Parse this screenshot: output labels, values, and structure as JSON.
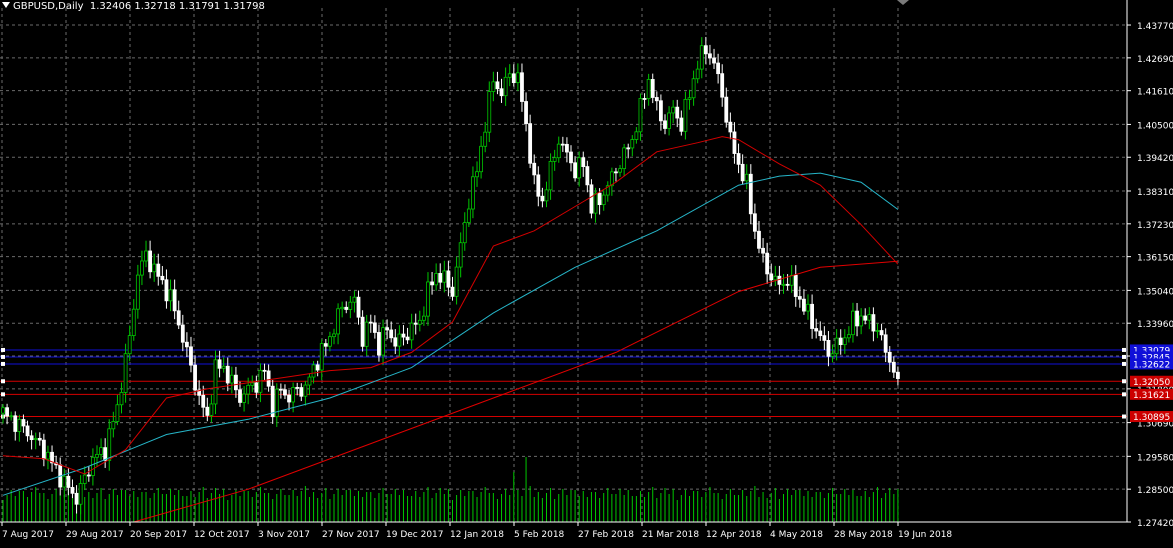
{
  "header": {
    "symbol": "GBPUSD,Daily",
    "ohlc": "1.32406 1.32718 1.31791 1.31798"
  },
  "colors": {
    "background": "#000000",
    "grid": "#6b6b6b",
    "candle_up": "#00c800",
    "candle_body_up": "#000000",
    "candle_down": "#ffffff",
    "volume": "#00c800",
    "ma_red": "#d40000",
    "ma_cyan": "#26b5c8",
    "ma_redthick": "#e00000",
    "level_blue": "#1010d8",
    "level_red": "#d40000",
    "axis_text": "#ffffff"
  },
  "chart_data": {
    "type": "candlestick",
    "symbol": "GBPUSD",
    "timeframe": "Daily",
    "ylim": [
      1.2742,
      1.4433
    ],
    "y_ticks": [
      "1.43770",
      "1.42690",
      "1.41610",
      "1.40500",
      "1.39420",
      "1.38310",
      "1.37230",
      "1.36150",
      "1.35040",
      "1.33960",
      "1.32880",
      "1.31800",
      "1.30690",
      "1.29580",
      "1.28500",
      "1.27420"
    ],
    "x_ticks": [
      "7 Aug 2017",
      "29 Aug 2017",
      "20 Sep 2017",
      "12 Oct 2017",
      "3 Nov 2017",
      "27 Nov 2017",
      "19 Dec 2017",
      "12 Jan 2018",
      "5 Feb 2018",
      "27 Feb 2018",
      "21 Mar 2018",
      "12 Apr 2018",
      "4 May 2018",
      "28 May 2018",
      "19 Jun 2018"
    ],
    "close_path": [
      [
        0,
        1.31
      ],
      [
        5,
        1.305
      ],
      [
        10,
        1.298
      ],
      [
        15,
        1.287
      ],
      [
        18,
        1.282
      ],
      [
        22,
        1.295
      ],
      [
        25,
        1.298
      ],
      [
        28,
        1.312
      ],
      [
        31,
        1.335
      ],
      [
        33,
        1.356
      ],
      [
        35,
        1.362
      ],
      [
        38,
        1.355
      ],
      [
        41,
        1.348
      ],
      [
        44,
        1.335
      ],
      [
        46,
        1.325
      ],
      [
        48,
        1.315
      ],
      [
        50,
        1.308
      ],
      [
        52,
        1.325
      ],
      [
        54,
        1.325
      ],
      [
        56,
        1.32
      ],
      [
        58,
        1.315
      ],
      [
        60,
        1.318
      ],
      [
        62,
        1.32
      ],
      [
        64,
        1.324
      ],
      [
        66,
        1.312
      ],
      [
        68,
        1.318
      ],
      [
        70,
        1.315
      ],
      [
        72,
        1.318
      ],
      [
        74,
        1.318
      ],
      [
        76,
        1.325
      ],
      [
        78,
        1.33
      ],
      [
        80,
        1.335
      ],
      [
        83,
        1.345
      ],
      [
        86,
        1.347
      ],
      [
        88,
        1.335
      ],
      [
        90,
        1.34
      ],
      [
        92,
        1.332
      ],
      [
        94,
        1.338
      ],
      [
        96,
        1.333
      ],
      [
        98,
        1.335
      ],
      [
        100,
        1.338
      ],
      [
        102,
        1.34
      ],
      [
        104,
        1.35
      ],
      [
        106,
        1.356
      ],
      [
        108,
        1.354
      ],
      [
        110,
        1.35
      ],
      [
        112,
        1.365
      ],
      [
        114,
        1.38
      ],
      [
        116,
        1.39
      ],
      [
        118,
        1.405
      ],
      [
        120,
        1.42
      ],
      [
        122,
        1.415
      ],
      [
        124,
        1.422
      ],
      [
        126,
        1.42
      ],
      [
        128,
        1.405
      ],
      [
        130,
        1.385
      ],
      [
        132,
        1.38
      ],
      [
        134,
        1.39
      ],
      [
        136,
        1.4
      ],
      [
        138,
        1.395
      ],
      [
        140,
        1.39
      ],
      [
        142,
        1.392
      ],
      [
        144,
        1.378
      ],
      [
        146,
        1.38
      ],
      [
        148,
        1.385
      ],
      [
        150,
        1.39
      ],
      [
        152,
        1.395
      ],
      [
        154,
        1.4
      ],
      [
        156,
        1.41
      ],
      [
        158,
        1.42
      ],
      [
        160,
        1.41
      ],
      [
        162,
        1.405
      ],
      [
        164,
        1.41
      ],
      [
        166,
        1.405
      ],
      [
        168,
        1.415
      ],
      [
        170,
        1.425
      ],
      [
        172,
        1.43
      ],
      [
        174,
        1.425
      ],
      [
        176,
        1.415
      ],
      [
        178,
        1.4
      ],
      [
        180,
        1.392
      ],
      [
        182,
        1.385
      ],
      [
        184,
        1.37
      ],
      [
        186,
        1.36
      ],
      [
        188,
        1.355
      ],
      [
        190,
        1.352
      ],
      [
        192,
        1.354
      ],
      [
        194,
        1.35
      ],
      [
        196,
        1.345
      ],
      [
        198,
        1.34
      ],
      [
        200,
        1.335
      ],
      [
        202,
        1.33
      ],
      [
        204,
        1.332
      ],
      [
        206,
        1.335
      ],
      [
        208,
        1.34
      ],
      [
        210,
        1.342
      ],
      [
        212,
        1.34
      ],
      [
        214,
        1.338
      ],
      [
        216,
        1.33
      ],
      [
        218,
        1.325
      ],
      [
        219,
        1.318
      ]
    ],
    "ma_red": [
      [
        0,
        1.296
      ],
      [
        10,
        1.295
      ],
      [
        20,
        1.29
      ],
      [
        30,
        1.298
      ],
      [
        40,
        1.315
      ],
      [
        50,
        1.318
      ],
      [
        60,
        1.32
      ],
      [
        70,
        1.322
      ],
      [
        80,
        1.324
      ],
      [
        90,
        1.325
      ],
      [
        100,
        1.33
      ],
      [
        110,
        1.34
      ],
      [
        120,
        1.365
      ],
      [
        130,
        1.37
      ],
      [
        140,
        1.378
      ],
      [
        150,
        1.386
      ],
      [
        160,
        1.396
      ],
      [
        170,
        1.399
      ],
      [
        176,
        1.401
      ],
      [
        180,
        1.4
      ],
      [
        190,
        1.392
      ],
      [
        200,
        1.385
      ],
      [
        210,
        1.372
      ],
      [
        219,
        1.359
      ]
    ],
    "ma_cyan": [
      [
        0,
        1.283
      ],
      [
        20,
        1.292
      ],
      [
        40,
        1.303
      ],
      [
        60,
        1.308
      ],
      [
        80,
        1.315
      ],
      [
        100,
        1.325
      ],
      [
        120,
        1.343
      ],
      [
        140,
        1.358
      ],
      [
        160,
        1.37
      ],
      [
        180,
        1.385
      ],
      [
        190,
        1.388
      ],
      [
        200,
        1.389
      ],
      [
        210,
        1.386
      ],
      [
        219,
        1.377
      ]
    ],
    "ma_slow_red": [
      [
        32,
        1.2742
      ],
      [
        60,
        1.285
      ],
      [
        90,
        1.3
      ],
      [
        120,
        1.315
      ],
      [
        150,
        1.33
      ],
      [
        180,
        1.35
      ],
      [
        200,
        1.358
      ],
      [
        219,
        1.36
      ]
    ],
    "volume_spike_index": 128,
    "horizontal_levels": [
      {
        "price": 1.3308,
        "color": "blue",
        "label": "1.33079"
      },
      {
        "price": 1.3285,
        "color": "blue",
        "label": "1.32845"
      },
      {
        "price": 1.3262,
        "color": "blue",
        "label": "1.32622"
      },
      {
        "price": 1.3205,
        "color": "red",
        "label": "1.32050"
      },
      {
        "price": 1.3162,
        "color": "red",
        "label": "1.31621"
      },
      {
        "price": 1.3089,
        "color": "red",
        "label": "1.30895"
      }
    ]
  }
}
